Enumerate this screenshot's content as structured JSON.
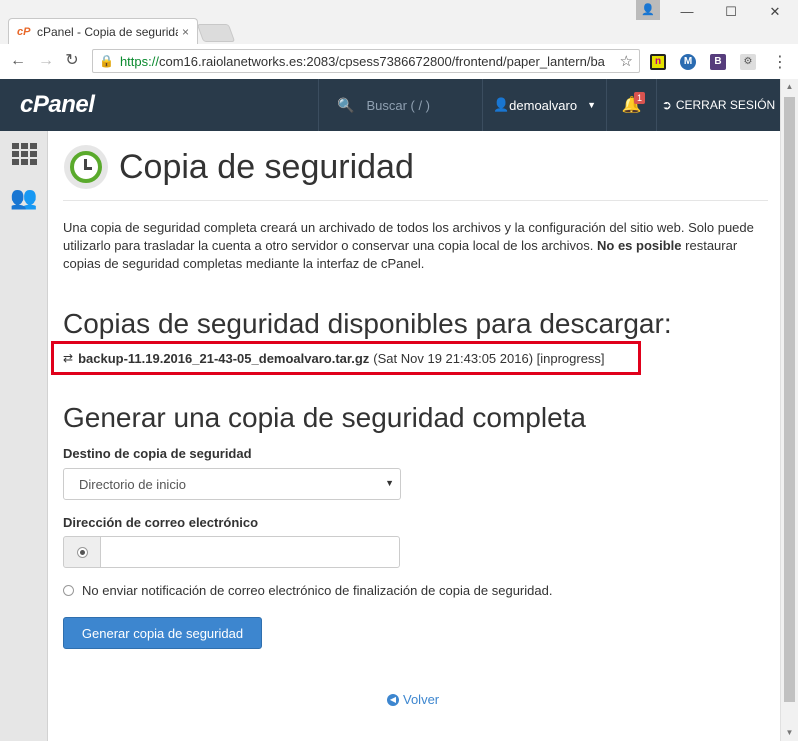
{
  "browser": {
    "tab_title": "cPanel - Copia de segurida",
    "tab_close": "×",
    "favicon": "cP",
    "url_scheme": "https://",
    "url_rest": "com16.raiolanetworks.es:2083/cpsess7386672800/frontend/paper_lantern/ba",
    "ext_labels": [
      "n",
      "M",
      "B",
      ""
    ]
  },
  "header": {
    "logo": "cPanel",
    "search_placeholder": "Buscar ( / )",
    "username": "demoalvaro",
    "notifications_count": "1",
    "logout_label": "CERRAR SESIÓN"
  },
  "page": {
    "title": "Copia de seguridad",
    "intro_1": "Una copia de seguridad completa creará un archivado de todos los archivos y la configuración del sitio web. Solo puede utilizarlo para trasladar la cuenta a otro servidor o conservar una copia local de los archivos. ",
    "intro_bold": "No es posible",
    "intro_2": " restaurar copias de seguridad completas mediante la interfaz de cPanel.",
    "available_heading": "Copias de seguridad disponibles para descargar:",
    "backup": {
      "filename": "backup-11.19.2016_21-43-05_demoalvaro.tar.gz",
      "meta": "(Sat Nov 19 21:43:05 2016) [inprogress]"
    },
    "generate_heading": "Generar una copia de seguridad completa",
    "destination_label": "Destino de copia de seguridad",
    "destination_value": "Directorio de inicio",
    "email_label": "Dirección de correo electrónico",
    "email_value": "",
    "no_email_label": "No enviar notificación de correo electrónico de finalización de copia de seguridad.",
    "generate_button": "Generar copia de seguridad",
    "back_link": "Volver"
  },
  "colors": {
    "header_bg": "#293a4a",
    "primary": "#3d86cf",
    "highlight_border": "#e0001b",
    "icon_green": "#5aaa2c"
  }
}
